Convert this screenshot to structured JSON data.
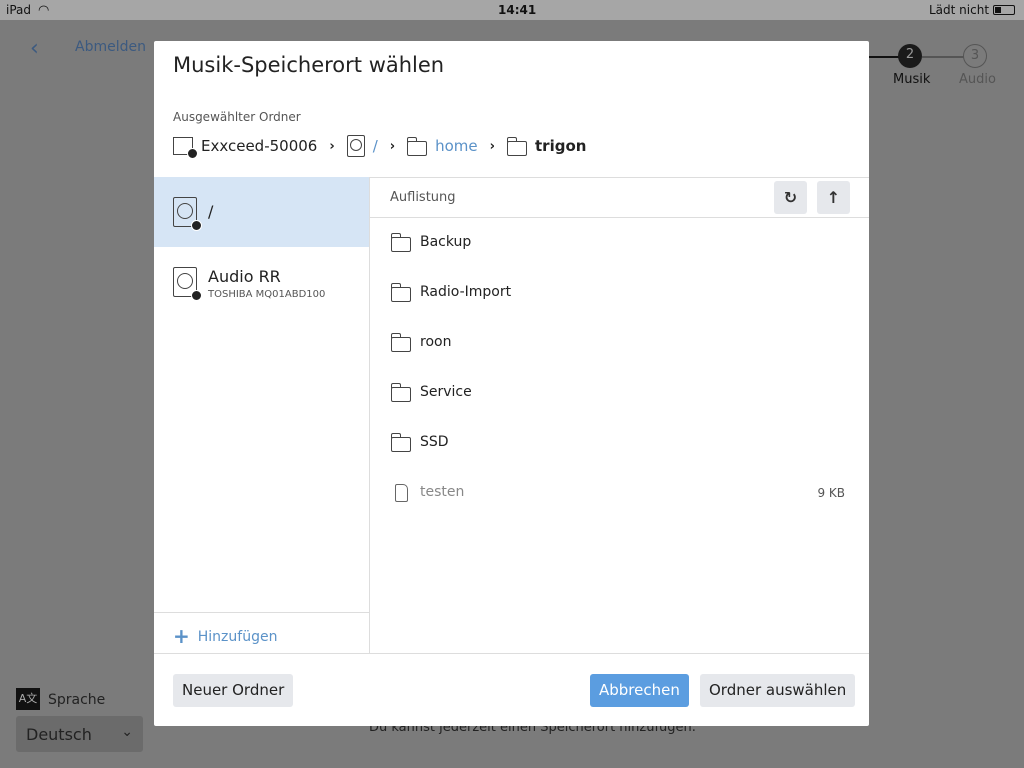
{
  "status_bar": {
    "device": "iPad",
    "time": "14:41",
    "battery": "Lädt nicht"
  },
  "background": {
    "back_label": "Abmelden",
    "steps": [
      {
        "number": "2",
        "label": "Musik"
      },
      {
        "number": "3",
        "label": "Audio"
      }
    ],
    "language_label": "Sprache",
    "language_value": "Deutsch",
    "hint": "Du kannst jederzeit einen Speicherort hinzufügen."
  },
  "dialog": {
    "title": "Musik-Speicherort wählen",
    "selected_label": "Ausgewählter Ordner",
    "breadcrumb": [
      "Exxceed-50006",
      "/",
      "home",
      "trigon"
    ],
    "volumes": [
      {
        "name": "/",
        "sub": ""
      },
      {
        "name": "Audio RR",
        "sub": "TOSHIBA MQ01ABD100"
      }
    ],
    "add_label": "Hinzufügen",
    "list_header": "Auflistung",
    "items": [
      {
        "name": "Backup",
        "type": "folder"
      },
      {
        "name": "Radio-Import",
        "type": "folder"
      },
      {
        "name": "roon",
        "type": "folder"
      },
      {
        "name": "Service",
        "type": "folder"
      },
      {
        "name": "SSD",
        "type": "folder"
      },
      {
        "name": "testen",
        "type": "file",
        "size": "9 KB"
      }
    ],
    "new_folder": "Neuer Ordner",
    "cancel": "Abbrechen",
    "select": "Ordner auswählen"
  }
}
